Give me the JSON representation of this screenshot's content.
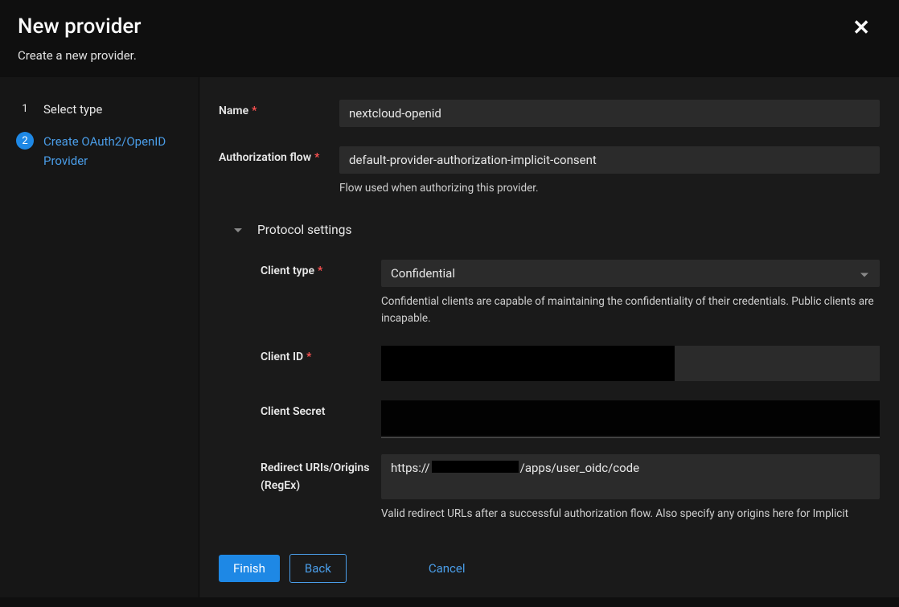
{
  "header": {
    "title": "New provider",
    "subtitle": "Create a new provider."
  },
  "steps": [
    {
      "num": "1",
      "label": "Select type"
    },
    {
      "num": "2",
      "label": "Create OAuth2/OpenID Provider"
    }
  ],
  "form": {
    "name": {
      "label": "Name",
      "value": "nextcloud-openid"
    },
    "auth_flow": {
      "label": "Authorization flow",
      "value": "default-provider-authorization-implicit-consent",
      "help": "Flow used when authorizing this provider."
    },
    "protocol_section_title": "Protocol settings",
    "client_type": {
      "label": "Client type",
      "value": "Confidential",
      "help": "Confidential clients are capable of maintaining the confidentiality of their credentials. Public clients are incapable."
    },
    "client_id": {
      "label": "Client ID"
    },
    "client_secret": {
      "label": "Client Secret"
    },
    "redirect": {
      "label": "Redirect URIs/Origins (RegEx)",
      "prefix": "https://",
      "suffix": "/apps/user_oidc/code",
      "help": "Valid redirect URLs after a successful authorization flow. Also specify any origins here for Implicit"
    }
  },
  "buttons": {
    "finish": "Finish",
    "back": "Back",
    "cancel": "Cancel"
  }
}
